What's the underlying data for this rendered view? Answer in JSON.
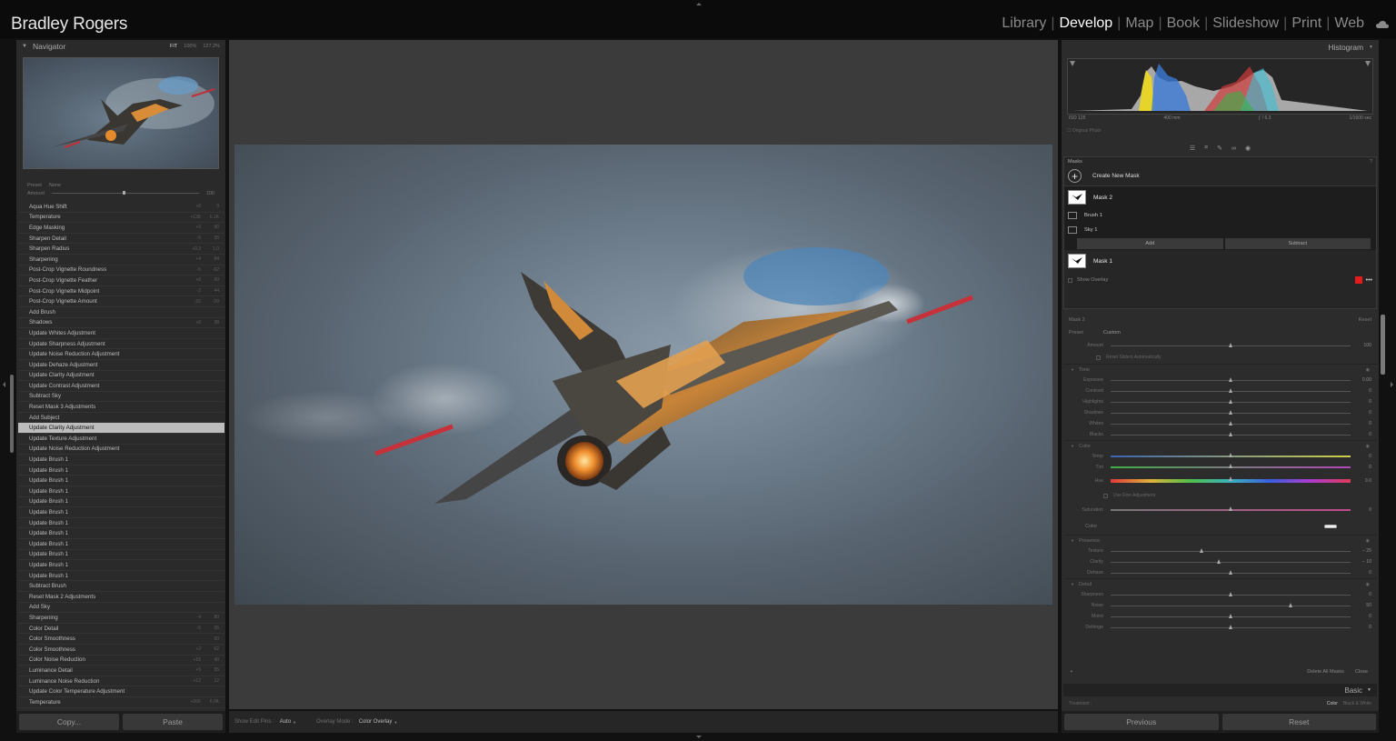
{
  "identity_plate": "Bradley Rogers",
  "modules": [
    "Library",
    "Develop",
    "Map",
    "Book",
    "Slideshow",
    "Print",
    "Web"
  ],
  "active_module": "Develop",
  "navigator": {
    "title": "Navigator",
    "zoom_options": [
      "FIT",
      "100%",
      "127.2%"
    ],
    "zoom_selected": "FIT"
  },
  "history_header": {
    "preset_label": "Preset",
    "preset_value": "None",
    "amount_label": "Amount",
    "amount_value": "100"
  },
  "history": [
    {
      "label": "Aqua Hue Shift",
      "a": "+8",
      "b": "0"
    },
    {
      "label": "Temperature",
      "a": "+138",
      "b": "6.1K"
    },
    {
      "label": "Edge Masking",
      "a": "+9",
      "b": "90"
    },
    {
      "label": "Sharpen Detail",
      "a": "-5",
      "b": "25"
    },
    {
      "label": "Sharpen Radius",
      "a": "+0.3",
      "b": "1.0"
    },
    {
      "label": "Sharpening",
      "a": "+4",
      "b": "84"
    },
    {
      "label": "Post-Crop Vignette Roundness",
      "a": "-5",
      "b": "-62"
    },
    {
      "label": "Post-Crop Vignette Feather",
      "a": "+8",
      "b": "60"
    },
    {
      "label": "Post-Crop Vignette Midpoint",
      "a": "-2",
      "b": "44"
    },
    {
      "label": "Post-Crop Vignette Amount",
      "a": "-20",
      "b": "-20"
    },
    {
      "label": "Add Brush",
      "a": "",
      "b": ""
    },
    {
      "label": "Shadows",
      "a": "+8",
      "b": "38"
    },
    {
      "label": "Update Whites Adjustment",
      "a": "",
      "b": ""
    },
    {
      "label": "Update Sharpness Adjustment",
      "a": "",
      "b": ""
    },
    {
      "label": "Update Noise Reduction Adjustment",
      "a": "",
      "b": ""
    },
    {
      "label": "Update Dehaze Adjustment",
      "a": "",
      "b": ""
    },
    {
      "label": "Update Clarity Adjustment",
      "a": "",
      "b": ""
    },
    {
      "label": "Update Contrast Adjustment",
      "a": "",
      "b": ""
    },
    {
      "label": "Subtract Sky",
      "a": "",
      "b": ""
    },
    {
      "label": "Reset Mask 3 Adjustments",
      "a": "",
      "b": ""
    },
    {
      "label": "Add Subject",
      "a": "",
      "b": ""
    },
    {
      "label": "Update Clarity Adjustment",
      "a": "",
      "b": "",
      "selected": true
    },
    {
      "label": "Update Texture Adjustment",
      "a": "",
      "b": ""
    },
    {
      "label": "Update Noise Reduction Adjustment",
      "a": "",
      "b": ""
    },
    {
      "label": "Update Brush 1",
      "a": "",
      "b": ""
    },
    {
      "label": "Update Brush 1",
      "a": "",
      "b": ""
    },
    {
      "label": "Update Brush 1",
      "a": "",
      "b": ""
    },
    {
      "label": "Update Brush 1",
      "a": "",
      "b": ""
    },
    {
      "label": "Update Brush 1",
      "a": "",
      "b": ""
    },
    {
      "label": "Update Brush 1",
      "a": "",
      "b": ""
    },
    {
      "label": "Update Brush 1",
      "a": "",
      "b": ""
    },
    {
      "label": "Update Brush 1",
      "a": "",
      "b": ""
    },
    {
      "label": "Update Brush 1",
      "a": "",
      "b": ""
    },
    {
      "label": "Update Brush 1",
      "a": "",
      "b": ""
    },
    {
      "label": "Update Brush 1",
      "a": "",
      "b": ""
    },
    {
      "label": "Update Brush 1",
      "a": "",
      "b": ""
    },
    {
      "label": "Subtract Brush",
      "a": "",
      "b": ""
    },
    {
      "label": "Reset Mask 2 Adjustments",
      "a": "",
      "b": ""
    },
    {
      "label": "Add Sky",
      "a": "",
      "b": ""
    },
    {
      "label": "Sharpening",
      "a": "-4",
      "b": "80"
    },
    {
      "label": "Color Detail",
      "a": "-5",
      "b": "55"
    },
    {
      "label": "Color Smoothness",
      "a": "",
      "b": "60"
    },
    {
      "label": "Color Smoothness",
      "a": "+2",
      "b": "62"
    },
    {
      "label": "Color Noise Reduction",
      "a": "+15",
      "b": "40"
    },
    {
      "label": "Luminance Detail",
      "a": "+5",
      "b": "55"
    },
    {
      "label": "Luminance Noise Reduction",
      "a": "+12",
      "b": "12"
    },
    {
      "label": "Update Color Temperature Adjustment",
      "a": "",
      "b": ""
    },
    {
      "label": "Temperature",
      "a": "+200",
      "b": "6.0K"
    }
  ],
  "left_buttons": {
    "copy": "Copy...",
    "paste": "Paste"
  },
  "toolbar": {
    "edit_pins_label": "Show Edit Pins :",
    "edit_pins_value": "Auto",
    "overlay_mode_label": "Overlay Mode :",
    "overlay_mode_value": "Color Overlay"
  },
  "histogram": {
    "title": "Histogram",
    "iso": "ISO 125",
    "focal": "400 mm",
    "aperture": "ƒ / 6.3",
    "shutter": "1/1600 sec",
    "original_photo": "Original Photo"
  },
  "masks": {
    "title": "Masks",
    "create": "Create New Mask",
    "mask2": "Mask 2",
    "brush1": "Brush 1",
    "sky1": "Sky 1",
    "add": "Add",
    "subtract": "Subtract",
    "mask1": "Mask 1",
    "show_overlay": "Show Overlay",
    "overlay_color": "#e31b1b"
  },
  "adjust": {
    "mask_name": "Mask 2",
    "reset": "Reset",
    "preset_label": "Preset",
    "preset_value": "Custom",
    "amount_label": "Amount",
    "amount_value": "100",
    "amount_level": 0.5,
    "reset_auto": "Reset Sliders Automatically",
    "tone": {
      "title": "Tone",
      "sliders": [
        {
          "label": "Exposure",
          "value": "0.00",
          "pos": 0.5
        },
        {
          "label": "Contrast",
          "value": "0",
          "pos": 0.5
        },
        {
          "label": "Highlights",
          "value": "0",
          "pos": 0.5
        },
        {
          "label": "Shadows",
          "value": "0",
          "pos": 0.5
        },
        {
          "label": "Whites",
          "value": "0",
          "pos": 0.5
        },
        {
          "label": "Blacks",
          "value": "0",
          "pos": 0.5
        }
      ]
    },
    "color": {
      "title": "Color",
      "temp": {
        "label": "Temp",
        "value": "0",
        "pos": 0.5
      },
      "tint": {
        "label": "Tint",
        "value": "0",
        "pos": 0.5
      },
      "hue": {
        "label": "Hue",
        "value": "0.0",
        "pos": 0.5
      },
      "fine": "Use Fine Adjustment",
      "saturation": {
        "label": "Saturation",
        "value": "0",
        "pos": 0.5
      },
      "color_label": "Color"
    },
    "presence": {
      "title": "Presence",
      "sliders": [
        {
          "label": "Texture",
          "value": "− 25",
          "pos": 0.38
        },
        {
          "label": "Clarity",
          "value": "− 10",
          "pos": 0.45
        },
        {
          "label": "Dehaze",
          "value": "0",
          "pos": 0.5
        }
      ]
    },
    "detail": {
      "title": "Detail",
      "sliders": [
        {
          "label": "Sharpness",
          "value": "0",
          "pos": 0.5
        },
        {
          "label": "Noise",
          "value": "50",
          "pos": 0.75
        },
        {
          "label": "Moiré",
          "value": "0",
          "pos": 0.5
        },
        {
          "label": "Defringe",
          "value": "0",
          "pos": 0.5
        }
      ]
    }
  },
  "delete_all": "Delete All Masks",
  "close": "Close",
  "basic": "Basic",
  "treatment": {
    "label": "Treatment :",
    "color": "Color",
    "bw": "Black & White"
  },
  "right_buttons": {
    "previous": "Previous",
    "reset": "Reset"
  }
}
